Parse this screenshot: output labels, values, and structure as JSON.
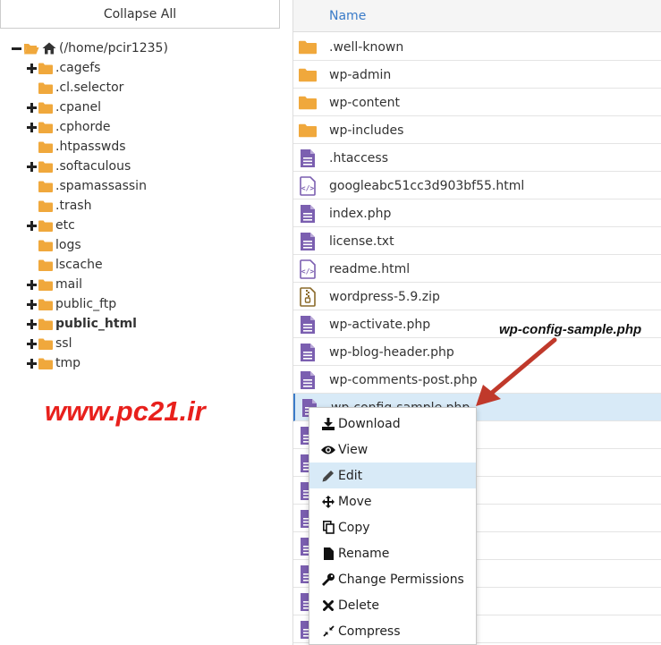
{
  "tree": {
    "collapse_label": "Collapse All",
    "root_label": "(/home/pcir1235)",
    "items": [
      {
        "label": ".cagefs",
        "expandable": true
      },
      {
        "label": ".cl.selector",
        "expandable": false
      },
      {
        "label": ".cpanel",
        "expandable": true
      },
      {
        "label": ".cphorde",
        "expandable": true
      },
      {
        "label": ".htpasswds",
        "expandable": false
      },
      {
        "label": ".softaculous",
        "expandable": true
      },
      {
        "label": ".spamassassin",
        "expandable": false
      },
      {
        "label": ".trash",
        "expandable": false
      },
      {
        "label": "etc",
        "expandable": true
      },
      {
        "label": "logs",
        "expandable": false
      },
      {
        "label": "lscache",
        "expandable": false
      },
      {
        "label": "mail",
        "expandable": true
      },
      {
        "label": "public_ftp",
        "expandable": true
      },
      {
        "label": "public_html",
        "expandable": true,
        "bold": true
      },
      {
        "label": "ssl",
        "expandable": true
      },
      {
        "label": "tmp",
        "expandable": true
      }
    ]
  },
  "watermark": "www.pc21.ir",
  "files": {
    "header_name": "Name",
    "rows": [
      {
        "name": ".well-known",
        "type": "folder"
      },
      {
        "name": "wp-admin",
        "type": "folder"
      },
      {
        "name": "wp-content",
        "type": "folder"
      },
      {
        "name": "wp-includes",
        "type": "folder"
      },
      {
        "name": ".htaccess",
        "type": "text"
      },
      {
        "name": "googleabc51cc3d903bf55.html",
        "type": "code"
      },
      {
        "name": "index.php",
        "type": "text"
      },
      {
        "name": "license.txt",
        "type": "text"
      },
      {
        "name": "readme.html",
        "type": "code"
      },
      {
        "name": "wordpress-5.9.zip",
        "type": "zip"
      },
      {
        "name": "wp-activate.php",
        "type": "text"
      },
      {
        "name": "wp-blog-header.php",
        "type": "text"
      },
      {
        "name": "wp-comments-post.php",
        "type": "text"
      },
      {
        "name": "wp-config-sample.php",
        "type": "text",
        "selected": true
      },
      {
        "name": "",
        "type": "text"
      },
      {
        "name": "",
        "type": "text"
      },
      {
        "name": "",
        "type": "text"
      },
      {
        "name": "",
        "type": "text"
      },
      {
        "name": "",
        "type": "text"
      },
      {
        "name": "",
        "type": "text"
      },
      {
        "name": "",
        "type": "text"
      },
      {
        "name": "",
        "type": "text"
      },
      {
        "name": "",
        "type": "text"
      }
    ]
  },
  "annotation": "wp-config-sample.php",
  "context_menu": {
    "items": [
      {
        "label": "Download",
        "icon": "download-icon"
      },
      {
        "label": "View",
        "icon": "eye-icon"
      },
      {
        "label": "Edit",
        "icon": "pencil-icon",
        "hover": true
      },
      {
        "label": "Move",
        "icon": "move-icon"
      },
      {
        "label": "Copy",
        "icon": "copy-icon"
      },
      {
        "label": "Rename",
        "icon": "file-icon"
      },
      {
        "label": "Change Permissions",
        "icon": "key-icon"
      },
      {
        "label": "Delete",
        "icon": "close-icon"
      },
      {
        "label": "Compress",
        "icon": "compress-icon"
      }
    ]
  },
  "colors": {
    "folder": "#f0a83c",
    "file_purple": "#7b5fb0",
    "header_link": "#3a7bc8",
    "selected_row": "#d8eaf7",
    "watermark": "#e8201c",
    "arrow": "#c0392b"
  }
}
